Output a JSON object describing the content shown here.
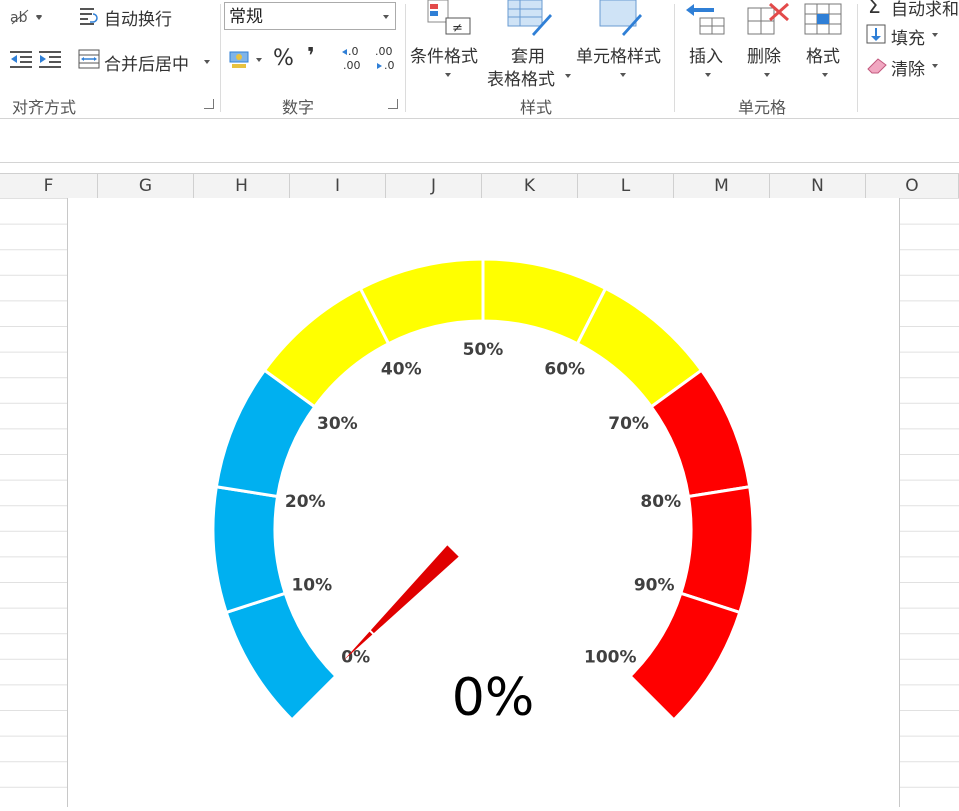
{
  "ribbon": {
    "alignment": {
      "wrap_text": "自动换行",
      "merge_center": "合并后居中",
      "group_label": "对齐方式"
    },
    "number": {
      "format_value": "常规",
      "percent": "%",
      "comma": "❜",
      "inc_decimal": ".00",
      "dec_decimal": ".00",
      "group_label": "数字"
    },
    "styles": {
      "conditional": "条件格式",
      "table_line1": "套用",
      "table_line2": "表格格式",
      "cell_styles": "单元格样式",
      "group_label": "样式"
    },
    "cells": {
      "insert": "插入",
      "delete": "删除",
      "format": "格式",
      "group_label": "单元格"
    },
    "editing": {
      "autosum": "自动求和",
      "fill": "填充",
      "clear": "清除"
    }
  },
  "columns": [
    "F",
    "G",
    "H",
    "I",
    "J",
    "K",
    "L",
    "M",
    "N",
    "O"
  ],
  "gauge": {
    "value_text": "0%",
    "value": 0,
    "tick_labels": [
      "0%",
      "10%",
      "20%",
      "30%",
      "40%",
      "50%",
      "60%",
      "70%",
      "80%",
      "90%",
      "100%"
    ],
    "band_colors": [
      "#00b0f0",
      "#00b0f0",
      "#00b0f0",
      "#ffff00",
      "#ffff00",
      "#ffff00",
      "#ffff00",
      "#ff0000",
      "#ff0000",
      "#ff0000"
    ],
    "needle_color": "#e00000"
  }
}
